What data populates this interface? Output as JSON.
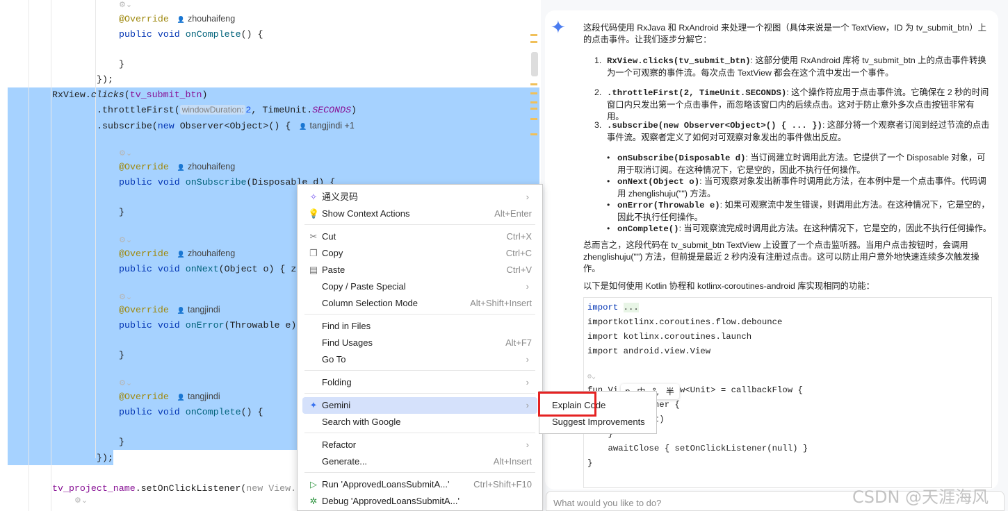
{
  "editor": {
    "lines": [
      {
        "tokens": [
          {
            "t": "⚙⌄",
            "k": "ai"
          }
        ]
      },
      {
        "tokens": [
          {
            "t": "@Override",
            "k": "an"
          },
          {
            "t": "zhouhaifeng",
            "k": "author"
          }
        ]
      },
      {
        "tokens": [
          {
            "t": "public void ",
            "k": "kw"
          },
          {
            "t": "onComplete",
            "k": "fn"
          },
          {
            "t": "() {",
            "k": ""
          }
        ]
      },
      {
        "tokens": []
      },
      {
        "tokens": [
          {
            "t": "}",
            "k": ""
          }
        ]
      },
      {
        "tokens": [
          {
            "t": "});",
            "k": ""
          }
        ]
      },
      {
        "tokens": [
          {
            "t": "RxView.",
            "k": ""
          },
          {
            "t": "clicks",
            "k": "it"
          },
          {
            "t": "(",
            "k": ""
          },
          {
            "t": "tv_submit_btn",
            "k": "fld"
          },
          {
            "t": ")",
            "k": ""
          }
        ]
      },
      {
        "tokens": [
          {
            "t": ".throttleFirst(",
            "k": ""
          },
          {
            "t": "windowDuration:",
            "k": "hint"
          },
          {
            "t": "2",
            "k": "num"
          },
          {
            "t": ", TimeUnit.",
            "k": ""
          },
          {
            "t": "SECONDS",
            "k": "fld it"
          },
          {
            "t": ")",
            "k": ""
          }
        ]
      },
      {
        "tokens": [
          {
            "t": ".subscribe(",
            "k": ""
          },
          {
            "t": "new ",
            "k": "kw"
          },
          {
            "t": "Observer<Object>() {",
            "k": ""
          },
          {
            "t": "tangjindi +1",
            "k": "author"
          }
        ]
      },
      {
        "tokens": []
      },
      {
        "tokens": [
          {
            "t": "⚙⌄",
            "k": "ai"
          }
        ]
      },
      {
        "tokens": [
          {
            "t": "@Override",
            "k": "an"
          },
          {
            "t": "zhouhaifeng",
            "k": "author"
          }
        ]
      },
      {
        "tokens": [
          {
            "t": "public void ",
            "k": "kw"
          },
          {
            "t": "onSubscribe",
            "k": "fn"
          },
          {
            "t": "(Disposable d) {",
            "k": ""
          }
        ]
      },
      {
        "tokens": []
      },
      {
        "tokens": [
          {
            "t": "}",
            "k": ""
          }
        ]
      },
      {
        "tokens": []
      },
      {
        "tokens": [
          {
            "t": "⚙⌄",
            "k": "ai"
          }
        ]
      },
      {
        "tokens": [
          {
            "t": "@Override",
            "k": "an"
          },
          {
            "t": "zhouhaifeng",
            "k": "author"
          }
        ]
      },
      {
        "tokens": [
          {
            "t": "public void ",
            "k": "kw"
          },
          {
            "t": "onNext",
            "k": "fn"
          },
          {
            "t": "(Object o) { z",
            "k": ""
          }
        ]
      },
      {
        "tokens": [
          {
            "t": "⚙⌄",
            "k": "ai"
          }
        ]
      },
      {
        "tokens": [
          {
            "t": "@Override",
            "k": "an"
          },
          {
            "t": "tangjindi",
            "k": "author"
          }
        ]
      },
      {
        "tokens": [
          {
            "t": "public void ",
            "k": "kw"
          },
          {
            "t": "onError",
            "k": "fn"
          },
          {
            "t": "(Throwable e)",
            "k": ""
          }
        ]
      },
      {
        "tokens": []
      },
      {
        "tokens": [
          {
            "t": "}",
            "k": ""
          }
        ]
      },
      {
        "tokens": [
          {
            "t": "⚙⌄",
            "k": "ai"
          }
        ]
      },
      {
        "tokens": [
          {
            "t": "@Override",
            "k": "an"
          },
          {
            "t": "tangjindi",
            "k": "author"
          }
        ]
      },
      {
        "tokens": [
          {
            "t": "public void ",
            "k": "kw"
          },
          {
            "t": "onComplete",
            "k": "fn"
          },
          {
            "t": "() {",
            "k": ""
          }
        ]
      },
      {
        "tokens": []
      },
      {
        "tokens": [
          {
            "t": "}",
            "k": ""
          }
        ]
      },
      {
        "tokens": [
          {
            "t": "});",
            "k": ""
          }
        ]
      },
      {
        "tokens": []
      },
      {
        "tokens": [
          {
            "t": "tv_project_name",
            "k": "fld"
          },
          {
            "t": ".setOnClickListener(",
            "k": ""
          },
          {
            "t": "new View.",
            "k": "gray"
          }
        ]
      },
      {
        "tokens": [
          {
            "t": "⚙⌄",
            "k": "ai"
          }
        ]
      }
    ]
  },
  "context_menu": {
    "items": [
      {
        "label": "通义灵码",
        "icon": "tongyi-icon",
        "shortcut": "",
        "submenu": true
      },
      {
        "label": "Show Context Actions",
        "icon": "lightbulb-icon",
        "shortcut": "Alt+Enter",
        "submenu": false
      },
      {
        "label": "Cut",
        "icon": "scissors-icon",
        "shortcut": "Ctrl+X",
        "submenu": false
      },
      {
        "label": "Copy",
        "icon": "copy-icon",
        "shortcut": "Ctrl+C",
        "submenu": false
      },
      {
        "label": "Paste",
        "icon": "paste-icon",
        "shortcut": "Ctrl+V",
        "submenu": false
      },
      {
        "label": "Copy / Paste Special",
        "icon": "",
        "shortcut": "",
        "submenu": true
      },
      {
        "label": "Column Selection Mode",
        "icon": "",
        "shortcut": "Alt+Shift+Insert",
        "submenu": false
      },
      {
        "label": "Find in Files",
        "icon": "",
        "shortcut": "",
        "submenu": false
      },
      {
        "label": "Find Usages",
        "icon": "",
        "shortcut": "Alt+F7",
        "submenu": false
      },
      {
        "label": "Go To",
        "icon": "",
        "shortcut": "",
        "submenu": true
      },
      {
        "label": "Folding",
        "icon": "",
        "shortcut": "",
        "submenu": true
      },
      {
        "label": "Gemini",
        "icon": "gemini-icon",
        "shortcut": "",
        "submenu": true,
        "active": true
      },
      {
        "label": "Search with Google",
        "icon": "",
        "shortcut": "",
        "submenu": false
      },
      {
        "label": "Refactor",
        "icon": "",
        "shortcut": "",
        "submenu": true
      },
      {
        "label": "Generate...",
        "icon": "",
        "shortcut": "Alt+Insert",
        "submenu": false
      },
      {
        "label": "Run 'ApprovedLoansSubmitA...'",
        "icon": "run-icon",
        "shortcut": "Ctrl+Shift+F10",
        "submenu": false
      },
      {
        "label": "Debug 'ApprovedLoansSubmitA...'",
        "icon": "debug-icon",
        "shortcut": "",
        "submenu": false
      }
    ]
  },
  "gemini_submenu": {
    "items": [
      "Explain Code",
      "Suggest Improvements"
    ],
    "highlighted": "Explain Code",
    "highlight_color": "#e52222"
  },
  "panel": {
    "intro": "这段代码使用 RxJava 和 RxAndroid 来处理一个视图（具体来说是一个 TextView，ID 为 tv_submit_btn）上的点击事件。让我们逐步分解它：",
    "steps": [
      {
        "num": "1.",
        "code": "RxView.clicks(tv_submit_btn)",
        "text": ": 这部分使用 RxAndroid 库将 tv_submit_btn 上的点击事件转换为一个可观察的事件流。每次点击 TextView 都会在这个流中发出一个事件。"
      },
      {
        "num": "2.",
        "code": ".throttleFirst(2, TimeUnit.SECONDS)",
        "text": ": 这个操作符应用于点击事件流。它确保在 2 秒的时间窗口内只发出第一个点击事件，而忽略该窗口内的后续点击。这对于防止意外多次点击按钮非常有用。"
      },
      {
        "num": "3.",
        "code": ".subscribe(new Observer<Object>() { ... })",
        "text": ": 这部分将一个观察者订阅到经过节流的点击事件流。观察者定义了如何对可观察对象发出的事件做出反应。"
      }
    ],
    "bullets": [
      {
        "code": "onSubscribe(Disposable d)",
        "text": ": 当订阅建立时调用此方法。它提供了一个 Disposable 对象，可用于取消订阅。在这种情况下，它是空的，因此不执行任何操作。"
      },
      {
        "code": "onNext(Object o)",
        "text": ": 当可观察对象发出新事件时调用此方法，在本例中是一个点击事件。代码调用 zhenglishuju(\"\") 方法。"
      },
      {
        "code": "onError(Throwable e)",
        "text": ": 如果可观察流中发生错误，则调用此方法。在这种情况下，它是空的，因此不执行任何操作。"
      },
      {
        "code": "onComplete()",
        "text": ": 当可观察流完成时调用此方法。在这种情况下，它是空的，因此不执行任何操作。"
      }
    ],
    "summary": "总而言之，这段代码在 tv_submit_btn TextView 上设置了一个点击监听器。当用户点击按钮时，会调用 zhenglishuju(\"\") 方法，但前提是最近 2 秒内没有注册过点击。这可以防止用户意外地快速连续多次触发操作。",
    "kotlin_intro": "以下是如何使用 Kotlin 协程和 kotlinx-coroutines-android 库实现相同的功能：",
    "code_lines": [
      "import ...",
      "importkotlinx.coroutines.flow.debounce",
      "import kotlinx.coroutines.launch",
      "import android.view.View",
      "",
      "⚙⌄",
      "fun Vi          low<Unit> = callbackFlow {",
      "          stener {",
      "          Unit)",
      "    }",
      "    awaitClose { setOnClickListener(null) }",
      "}"
    ],
    "ime_toolbar": "ꝑ 中 °, 半",
    "input_placeholder": "What would you like to do?"
  },
  "watermark": "CSDN @天涯海风"
}
